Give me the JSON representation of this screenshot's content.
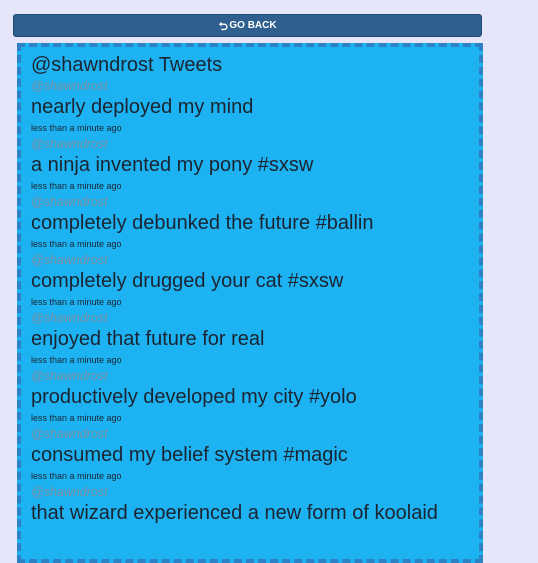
{
  "back_button": {
    "icon": "undo-icon",
    "label": "GO BACK"
  },
  "feed": {
    "title": "@shawndrost Tweets",
    "tweets": [
      {
        "handle": "@shawndrost",
        "text": "nearly deployed my mind",
        "time": "less than a minute ago"
      },
      {
        "handle": "@shawndrost",
        "text": "a ninja invented my pony #sxsw",
        "time": "less than a minute ago"
      },
      {
        "handle": "@shawndrost",
        "text": "completely debunked the future #ballin",
        "time": "less than a minute ago"
      },
      {
        "handle": "@shawndrost",
        "text": "completely drugged your cat #sxsw",
        "time": "less than a minute ago"
      },
      {
        "handle": "@shawndrost",
        "text": "enjoyed that future for real",
        "time": "less than a minute ago"
      },
      {
        "handle": "@shawndrost",
        "text": "productively developed my city #yolo",
        "time": "less than a minute ago"
      },
      {
        "handle": "@shawndrost",
        "text": "consumed my belief system #magic",
        "time": "less than a minute ago"
      },
      {
        "handle": "@shawndrost",
        "text": "that wizard experienced a new form of koolaid",
        "time": ""
      }
    ]
  }
}
